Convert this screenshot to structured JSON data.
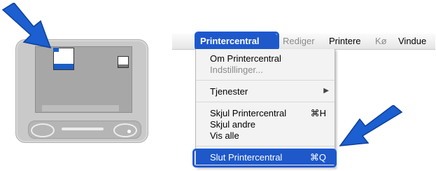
{
  "menubar": {
    "apple_icon": "apple-logo-icon",
    "items": [
      {
        "label": "Printercentral",
        "state": "active"
      },
      {
        "label": "Rediger",
        "state": "disabled"
      },
      {
        "label": "Printere",
        "state": "normal"
      },
      {
        "label": "Kø",
        "state": "disabled"
      },
      {
        "label": "Vindue",
        "state": "normal"
      }
    ]
  },
  "menu": {
    "items": [
      {
        "label": "Om Printercentral",
        "enabled": true,
        "shortcut": ""
      },
      {
        "label": "Indstillinger...",
        "enabled": false,
        "shortcut": ""
      },
      {
        "label": "Tjenester",
        "enabled": true,
        "submenu": true
      },
      {
        "label": "Skjul Printercentral",
        "enabled": true,
        "shortcut": "⌘H"
      },
      {
        "label": "Skjul andre",
        "enabled": true,
        "shortcut": ""
      },
      {
        "label": "Vis alle",
        "enabled": true,
        "shortcut": ""
      },
      {
        "label": "Slut Printercentral",
        "enabled": true,
        "shortcut": "⌘Q",
        "selected": true
      }
    ],
    "submenu_arrow": "▶"
  },
  "colors": {
    "highlight": "#1e58c9",
    "arrow": "#1b5fd0",
    "disabled_text": "#8a8a8a"
  },
  "illustration": {
    "device": "imac-icon",
    "arrow_icon": "pointer-arrow-icon"
  }
}
